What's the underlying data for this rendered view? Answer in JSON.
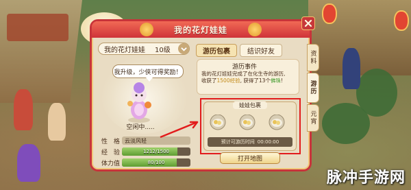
{
  "dialog": {
    "title": "我的花灯娃娃",
    "pet_name": "我的花灯娃娃",
    "pet_level": "10级",
    "speech": "我升级，少侠可得奖励！",
    "status": "空闲中.....",
    "stats": {
      "personality_label": "性 格",
      "personality_value": "云淡风轻",
      "exp_label": "经 验",
      "exp_text": "1212/1500",
      "exp_fraction": 0.808,
      "stamina_label": "体力值",
      "stamina_text": "80/100",
      "stamina_fraction": 0.8
    }
  },
  "tabs": [
    "游历包裹",
    "结识好友"
  ],
  "event": {
    "title": "游历事件",
    "line1": "我的花灯娃娃完成了在化生寺的游历,",
    "line2_a": "收获了",
    "line2_b": "1500经验",
    "line2_c": ", 获得了13个",
    "line2_d": "佛珠",
    "line2_e": "!"
  },
  "bag": {
    "title": "娃娃包裹",
    "items": [
      "bowl-icon",
      "bowl-icon",
      "bowl-icon"
    ],
    "timer_label": "预计可游历时间",
    "timer_value": "00:00:00"
  },
  "map_button": "打开地图",
  "side_tabs": [
    "资料",
    "游历",
    "元宵"
  ],
  "watermark": "脉冲手游网",
  "colors": {
    "frame_red": "#c8343a",
    "highlight_red": "#e21c1c",
    "panel_beige": "#e9dcc3"
  }
}
